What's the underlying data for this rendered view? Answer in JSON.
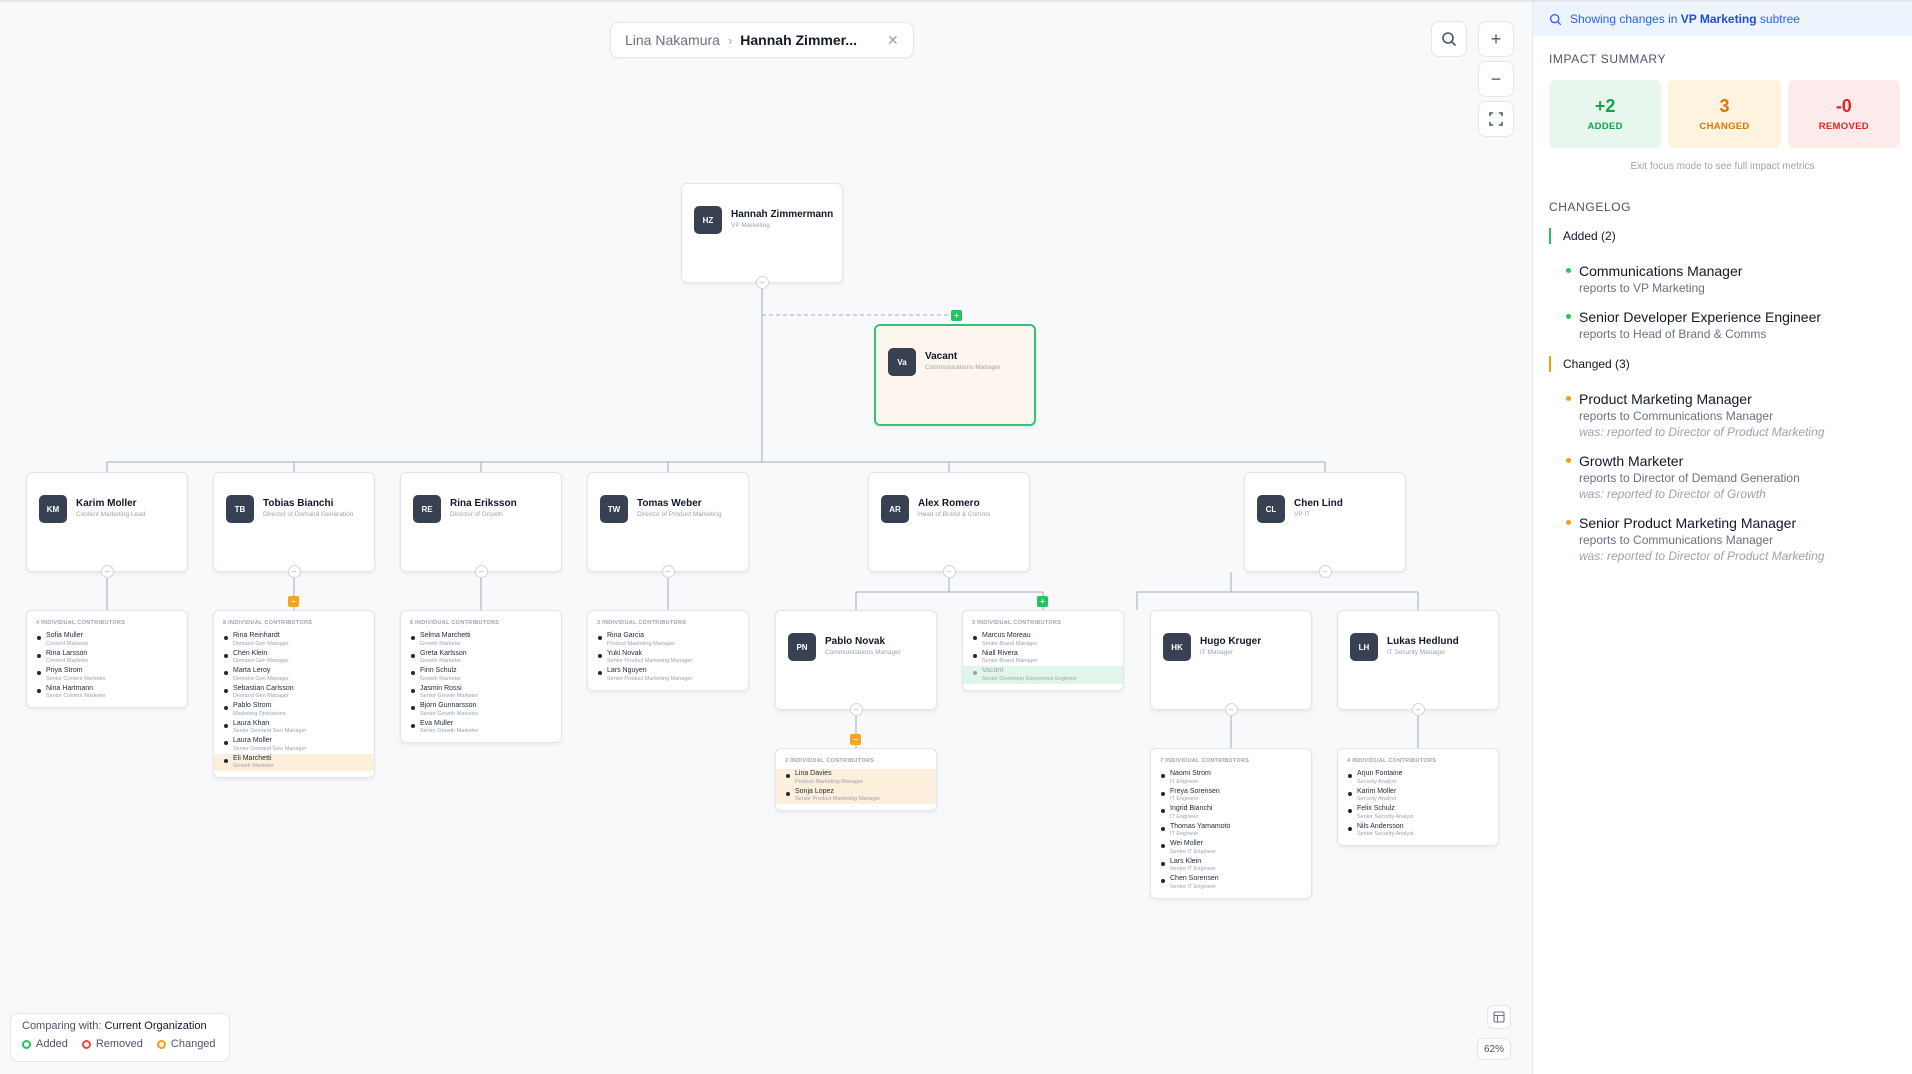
{
  "breadcrumb": {
    "root": "Lina Nakamura",
    "current": "Hannah Zimmer..."
  },
  "toolbar": {
    "search": "search-icon",
    "zoom_in": "+",
    "zoom_out": "−",
    "fit": "fullscreen-icon",
    "zoom_level": "62%"
  },
  "legend": {
    "comparing_label": "Comparing with:",
    "comparing_value": "Current Organization",
    "added": "Added",
    "removed": "Removed",
    "changed": "Changed"
  },
  "colors": {
    "added": "#22c55e",
    "removed": "#ef4444",
    "changed": "#f59e0b",
    "accent": "#2563eb"
  },
  "root": {
    "initials": "HZ",
    "name": "Hannah Zimmermann",
    "title": "VP Marketing"
  },
  "vacant": {
    "initials": "Va",
    "name": "Vacant",
    "title": "Communications Manager"
  },
  "managers": [
    {
      "initials": "KM",
      "name": "Karim Moller",
      "title": "Content Marketing Lead"
    },
    {
      "initials": "TB",
      "name": "Tobias Bianchi",
      "title": "Director of Demand Generation"
    },
    {
      "initials": "RE",
      "name": "Rina Eriksson",
      "title": "Director of Growth"
    },
    {
      "initials": "TW",
      "name": "Tomas Weber",
      "title": "Director of Product Marketing"
    },
    {
      "initials": "AR",
      "name": "Alex Romero",
      "title": "Head of Brand & Comms"
    },
    {
      "initials": "CL",
      "name": "Chen Lind",
      "title": "VP IT"
    }
  ],
  "sub_managers": [
    {
      "initials": "PN",
      "name": "Pablo Novak",
      "title": "Communications Manager"
    },
    {
      "initials": "HK",
      "name": "Hugo Kruger",
      "title": "IT Manager"
    },
    {
      "initials": "LH",
      "name": "Lukas Hedlund",
      "title": "IT Security Manager"
    }
  ],
  "ic_groups": [
    {
      "header": "4 INDIVIDUAL CONTRIBUTORS",
      "items": [
        {
          "name": "Sofia Muller",
          "role": "Content Marketer"
        },
        {
          "name": "Rina Larsson",
          "role": "Content Marketer"
        },
        {
          "name": "Priya Strom",
          "role": "Senior Content Marketer"
        },
        {
          "name": "Nina Hartmann",
          "role": "Senior Content Marketer"
        }
      ]
    },
    {
      "header": "8 INDIVIDUAL CONTRIBUTORS",
      "items": [
        {
          "name": "Rina Reinhardt",
          "role": "Demand Gen Manager"
        },
        {
          "name": "Chen Klein",
          "role": "Demand Gen Manager"
        },
        {
          "name": "Marta Leroy",
          "role": "Demand Gen Manager"
        },
        {
          "name": "Sebastian Carlsson",
          "role": "Demand Gen Manager"
        },
        {
          "name": "Pablo Strom",
          "role": "Marketing Operations"
        },
        {
          "name": "Laura Khan",
          "role": "Senior Demand Gen Manager"
        },
        {
          "name": "Laura Moller",
          "role": "Senior Demand Gen Manager"
        },
        {
          "name": "Eli Marchetti",
          "role": "Growth Marketer",
          "state": "changed"
        }
      ]
    },
    {
      "header": "6 INDIVIDUAL CONTRIBUTORS",
      "items": [
        {
          "name": "Selma Marchetti",
          "role": "Growth Marketer"
        },
        {
          "name": "Greta Karlsson",
          "role": "Growth Marketer"
        },
        {
          "name": "Finn Schulz",
          "role": "Growth Marketer"
        },
        {
          "name": "Jasmin Rossi",
          "role": "Senior Growth Marketer"
        },
        {
          "name": "Bjorn Gunnarsson",
          "role": "Senior Growth Marketer"
        },
        {
          "name": "Eva Muller",
          "role": "Senior Growth Marketer"
        }
      ]
    },
    {
      "header": "3 INDIVIDUAL CONTRIBUTORS",
      "items": [
        {
          "name": "Rina Garcia",
          "role": "Product Marketing Manager"
        },
        {
          "name": "Yuki Novak",
          "role": "Senior Product Marketing Manager"
        },
        {
          "name": "Lars Nguyen",
          "role": "Senior Product Marketing Manager"
        }
      ]
    },
    {
      "header": "3 INDIVIDUAL CONTRIBUTORS",
      "items": [
        {
          "name": "Marcus Moreau",
          "role": "Senior Brand Manager"
        },
        {
          "name": "Niall Rivera",
          "role": "Senior Brand Manager"
        },
        {
          "name": "Vacant",
          "role": "Senior Developer Experience Engineer",
          "state": "added"
        }
      ]
    },
    {
      "header": "2 INDIVIDUAL CONTRIBUTORS",
      "items": [
        {
          "name": "Lina Davies",
          "role": "Product Marketing Manager",
          "state": "changed"
        },
        {
          "name": "Sonja Lopez",
          "role": "Senior Product Marketing Manager",
          "state": "changed"
        }
      ]
    },
    {
      "header": "7 INDIVIDUAL CONTRIBUTORS",
      "items": [
        {
          "name": "Naomi Strom",
          "role": "IT Engineer"
        },
        {
          "name": "Freya Sorensen",
          "role": "IT Engineer"
        },
        {
          "name": "Ingrid Bianchi",
          "role": "IT Engineer"
        },
        {
          "name": "Thomas Yamamoto",
          "role": "IT Engineer"
        },
        {
          "name": "Wei Moller",
          "role": "Senior IT Engineer"
        },
        {
          "name": "Lars Klein",
          "role": "Senior IT Engineer"
        },
        {
          "name": "Chen Sorensen",
          "role": "Senior IT Engineer"
        }
      ]
    },
    {
      "header": "4 INDIVIDUAL CONTRIBUTORS",
      "items": [
        {
          "name": "Arjun Fontaine",
          "role": "Security Analyst"
        },
        {
          "name": "Karim Moller",
          "role": "Security Analyst"
        },
        {
          "name": "Felix Schulz",
          "role": "Senior Security Analyst"
        },
        {
          "name": "Nils Andersson",
          "role": "Senior Security Analyst"
        }
      ]
    }
  ],
  "panel": {
    "focus_prefix": "Showing changes in",
    "focus_subtree": "VP Marketing",
    "focus_suffix": "subtree",
    "impact_title": "IMPACT SUMMARY",
    "metrics": {
      "added_value": "+2",
      "added_label": "ADDED",
      "changed_value": "3",
      "changed_label": "CHANGED",
      "removed_value": "-0",
      "removed_label": "REMOVED"
    },
    "metrics_note": "Exit focus mode to see full impact metrics",
    "changelog_title": "CHANGELOG",
    "added_heading": "Added (2)",
    "added_items": [
      {
        "title": "Communications Manager",
        "sub": "reports to VP Marketing"
      },
      {
        "title": "Senior Developer Experience Engineer",
        "sub": "reports to Head of Brand & Comms"
      }
    ],
    "changed_heading": "Changed (3)",
    "changed_items": [
      {
        "title": "Product Marketing Manager",
        "sub": "reports to Communications Manager",
        "was": "was: reported to Director of Product Marketing"
      },
      {
        "title": "Growth Marketer",
        "sub": "reports to Director of Demand Generation",
        "was": "was: reported to Director of Growth"
      },
      {
        "title": "Senior Product Marketing Manager",
        "sub": "reports to Communications Manager",
        "was": "was: reported to Director of Product Marketing"
      }
    ]
  }
}
